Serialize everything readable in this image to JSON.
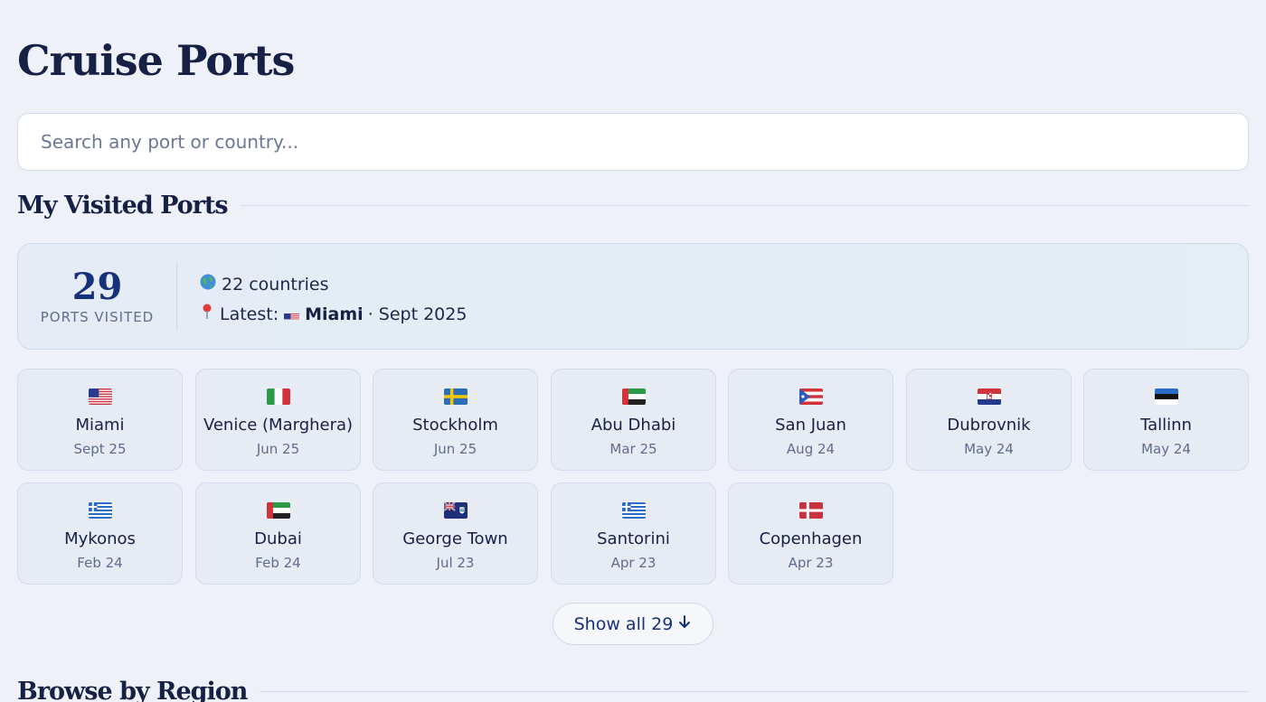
{
  "page": {
    "title": "Cruise Ports"
  },
  "search": {
    "placeholder": "Search any port or country..."
  },
  "visited": {
    "heading": "My Visited Ports",
    "count": "29",
    "count_label": "PORTS VISITED",
    "countries_icon": "globe-icon",
    "countries_text": "22 countries",
    "latest_icon": "pin-icon",
    "latest_prefix": "Latest:",
    "latest_flag": "us",
    "latest_port": "Miami",
    "latest_date": "· Sept 2025"
  },
  "ports": [
    {
      "name": "Miami",
      "date": "Sept 25",
      "flag": "us"
    },
    {
      "name": "Venice (Marghera)",
      "date": "Jun 25",
      "flag": "it"
    },
    {
      "name": "Stockholm",
      "date": "Jun 25",
      "flag": "se"
    },
    {
      "name": "Abu Dhabi",
      "date": "Mar 25",
      "flag": "ae"
    },
    {
      "name": "San Juan",
      "date": "Aug 24",
      "flag": "pr"
    },
    {
      "name": "Dubrovnik",
      "date": "May 24",
      "flag": "hr"
    },
    {
      "name": "Tallinn",
      "date": "May 24",
      "flag": "ee"
    },
    {
      "name": "Mykonos",
      "date": "Feb 24",
      "flag": "gr"
    },
    {
      "name": "Dubai",
      "date": "Feb 24",
      "flag": "ae"
    },
    {
      "name": "George Town",
      "date": "Jul 23",
      "flag": "ky"
    },
    {
      "name": "Santorini",
      "date": "Apr 23",
      "flag": "gr"
    },
    {
      "name": "Copenhagen",
      "date": "Apr 23",
      "flag": "dk"
    }
  ],
  "show_all": {
    "label": "Show all 29",
    "icon": "arrow-down-icon"
  },
  "browse": {
    "heading": "Browse by Region"
  },
  "colors": {
    "accent": "#16307a",
    "background": "#eef2f8",
    "card": "#e6ebf4",
    "border": "#d3dbec"
  }
}
